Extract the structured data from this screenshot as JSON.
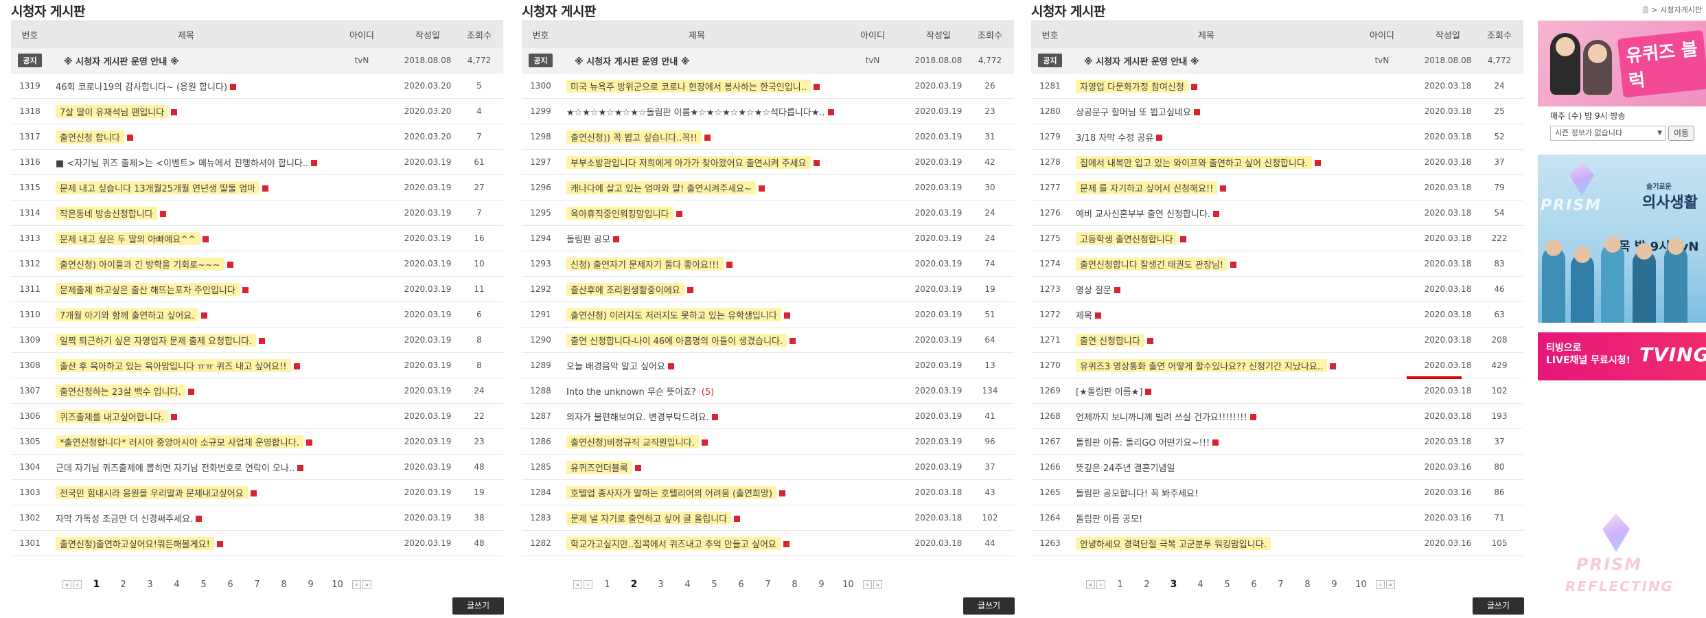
{
  "boards": [
    {
      "title": "시청자 게시판",
      "headers": {
        "num": "번호",
        "title": "제목",
        "id": "아이디",
        "date": "작성일",
        "views": "조회수"
      },
      "notice": {
        "badge": "공지",
        "title": "※ 시청자 게시판 운영 안내 ※",
        "id": "tvN",
        "date": "2018.08.08",
        "views": "4,772"
      },
      "rows": [
        {
          "num": "1319",
          "title": "46회 코로나19의 감사합니다~ (응원 합니다)",
          "date": "2020.03.20",
          "views": "5"
        },
        {
          "num": "1318",
          "title": "7살 딸이 유재석님 팬입니다",
          "date": "2020.03.20",
          "views": "4"
        },
        {
          "num": "1317",
          "title": "출연신청 합니다",
          "date": "2020.03.20",
          "views": "7"
        },
        {
          "num": "1316",
          "title": "■ <자기님 퀴즈 출제>는 <이벤트> 메뉴에서 진행하셔야 합니다..",
          "date": "2020.03.19",
          "views": "61"
        },
        {
          "num": "1315",
          "title": "문제 내고 싶습니다 13개월25개월 연년생 딸둘 엄마",
          "date": "2020.03.19",
          "views": "27"
        },
        {
          "num": "1314",
          "title": "작은동네 방송신청합니다",
          "date": "2020.03.19",
          "views": "7"
        },
        {
          "num": "1313",
          "title": "문제 내고 싶은 두 딸의 아빠예요^^",
          "date": "2020.03.19",
          "views": "16"
        },
        {
          "num": "1312",
          "title": "출연신청) 아이들과 긴 방학을 기회로~~~",
          "date": "2020.03.19",
          "views": "10"
        },
        {
          "num": "1311",
          "title": "문제출제 하고싶은 출산 해뜨는포차 주인입니다",
          "date": "2020.03.19",
          "views": "11"
        },
        {
          "num": "1310",
          "title": "7개월 아기와 함께 출연하고 싶어요.",
          "date": "2020.03.19",
          "views": "6"
        },
        {
          "num": "1309",
          "title": "일찍 퇴근하기 싶은 자영업자 문제 출제 요청합니다.",
          "date": "2020.03.19",
          "views": "8"
        },
        {
          "num": "1308",
          "title": "출산 후 육아하고 있는 육아맘입니다 ㅠㅠ 퀴즈 내고 싶어요!!",
          "date": "2020.03.19",
          "views": "8"
        },
        {
          "num": "1307",
          "title": "출연신청하는 23살 백수 입니다.",
          "date": "2020.03.19",
          "views": "24"
        },
        {
          "num": "1306",
          "title": "퀴즈출제를 내고싶어합니다.",
          "date": "2020.03.19",
          "views": "22"
        },
        {
          "num": "1305",
          "title": "*출연신청합니다* 러시아 중앙아시아 소규모 사업체 운영합니다.",
          "date": "2020.03.19",
          "views": "23"
        },
        {
          "num": "1304",
          "title": "근데 자기님 퀴즈출제에 뽑히면 자기님 전화번호로 연락이 오나..",
          "date": "2020.03.19",
          "views": "48"
        },
        {
          "num": "1303",
          "title": "전국민 힘내시라 응원을 우리말과 문제내고싶어요",
          "date": "2020.03.19",
          "views": "19"
        },
        {
          "num": "1302",
          "title": "자막 가독성 조금만 더 신경써주세요.",
          "date": "2020.03.19",
          "views": "38"
        },
        {
          "num": "1301",
          "title": "출연신청)출연하고싶어요!뭐든해볼게요!",
          "date": "2020.03.19",
          "views": "48"
        }
      ],
      "pages": [
        "1",
        "2",
        "3",
        "4",
        "5",
        "6",
        "7",
        "8",
        "9",
        "10"
      ],
      "active_page": "1",
      "write_label": "글쓰기"
    },
    {
      "title": "시청자 게시판",
      "headers": {
        "num": "번호",
        "title": "제목",
        "id": "아이디",
        "date": "작성일",
        "views": "조회수"
      },
      "notice": {
        "badge": "공지",
        "title": "※ 시청자 게시판 운영 안내 ※",
        "id": "tvN",
        "date": "2018.08.08",
        "views": "4,772"
      },
      "rows": [
        {
          "num": "1300",
          "title": "미국 뉴욕주 방위군으로 코로나 현장에서 봉사하는 한국인입니..",
          "date": "2020.03.19",
          "views": "26"
        },
        {
          "num": "1299",
          "title": "★☆★☆★☆★☆★☆돌림판 이름★☆★☆★☆★☆★☆석다릅니다★..",
          "date": "2020.03.19",
          "views": "23"
        },
        {
          "num": "1298",
          "title": "출연신청)) 꼭 뵙고 싶습니다..꼭!!",
          "date": "2020.03.19",
          "views": "31"
        },
        {
          "num": "1297",
          "title": "부부소방관입니다 저희에게 아가가 찾아왔어요 출연시켜 주세요",
          "date": "2020.03.19",
          "views": "42"
        },
        {
          "num": "1296",
          "title": "캐나다에 살고 있는 엄마와 딸! 출연시켜주세요~",
          "date": "2020.03.19",
          "views": "30"
        },
        {
          "num": "1295",
          "title": "육아휴직중인워킹맘입니다",
          "date": "2020.03.19",
          "views": "24"
        },
        {
          "num": "1294",
          "title": "돌림판 공모",
          "date": "2020.03.19",
          "views": "24"
        },
        {
          "num": "1293",
          "title": "신청) 출연자기 문제자기 둘다 좋아요!!!",
          "date": "2020.03.19",
          "views": "74"
        },
        {
          "num": "1292",
          "title": "출산후에 조리원생활중이에요",
          "date": "2020.03.19",
          "views": "19"
        },
        {
          "num": "1291",
          "title": "출연신청) 이러지도 저러지도 못하고 있는 유학생입니다",
          "date": "2020.03.19",
          "views": "51"
        },
        {
          "num": "1290",
          "title": "출연 신청합니다-나이 46에 아홉명의 아들이 생겼습니다.",
          "date": "2020.03.19",
          "views": "64"
        },
        {
          "num": "1289",
          "title": "오늘 배경음악 알고 싶어요",
          "date": "2020.03.19",
          "views": "13"
        },
        {
          "num": "1288",
          "title": "Into the unknown 무슨 뜻이죠?",
          "comments": "(5)",
          "date": "2020.03.19",
          "views": "134"
        },
        {
          "num": "1287",
          "title": "의자가 불편해보여요. 변경부탁드려요.",
          "date": "2020.03.19",
          "views": "41"
        },
        {
          "num": "1286",
          "title": "출연신청)비정규직 교직원입니다.",
          "date": "2020.03.19",
          "views": "96"
        },
        {
          "num": "1285",
          "title": "유퀴즈언더블록",
          "date": "2020.03.19",
          "views": "37"
        },
        {
          "num": "1284",
          "title": "호텔업 종사자가 말하는 호텔리어의 어려움 (출연희망)",
          "date": "2020.03.18",
          "views": "43"
        },
        {
          "num": "1283",
          "title": "문제 낼 자기로 출연하고 싶어 글 올립니다",
          "date": "2020.03.18",
          "views": "102"
        },
        {
          "num": "1282",
          "title": "학교가고싶지만..집콕에서 퀴즈내고 추억 만들고 싶어요",
          "date": "2020.03.18",
          "views": "44"
        }
      ],
      "pages": [
        "1",
        "2",
        "3",
        "4",
        "5",
        "6",
        "7",
        "8",
        "9",
        "10"
      ],
      "active_page": "2",
      "write_label": "글쓰기"
    },
    {
      "title": "시청자 게시판",
      "headers": {
        "num": "번호",
        "title": "제목",
        "id": "아이디",
        "date": "작성일",
        "views": "조회수"
      },
      "notice": {
        "badge": "공지",
        "title": "※ 시청자 게시판 운영 안내 ※",
        "id": "tvN",
        "date": "2018.08.08",
        "views": "4,772"
      },
      "rows": [
        {
          "num": "1281",
          "title": "자영업 다문화가정 참여신청",
          "date": "2020.03.18",
          "views": "24"
        },
        {
          "num": "1280",
          "title": "상공문구 할머님 또 뵙고싶네요",
          "date": "2020.03.18",
          "views": "25"
        },
        {
          "num": "1279",
          "title": "3/18 자막 수정 공유",
          "date": "2020.03.18",
          "views": "52"
        },
        {
          "num": "1278",
          "title": "집에서 내복만 입고 있는 와이프와 출연하고 싶어 신청합니다.",
          "date": "2020.03.18",
          "views": "37"
        },
        {
          "num": "1277",
          "title": "문제 를 자기하고 싶어서 신청해요!!",
          "date": "2020.03.18",
          "views": "79"
        },
        {
          "num": "1276",
          "title": "예비 교사신혼부부 출연 신청합니다.",
          "date": "2020.03.18",
          "views": "54"
        },
        {
          "num": "1275",
          "title": "고등학생 출연신청합니다",
          "date": "2020.03.18",
          "views": "222"
        },
        {
          "num": "1274",
          "title": "출연신청합니다 잘생긴 태권도 관장님!",
          "date": "2020.03.18",
          "views": "83"
        },
        {
          "num": "1273",
          "title": "영상 질문",
          "date": "2020.03.18",
          "views": "46"
        },
        {
          "num": "1272",
          "title": "제목",
          "date": "2020.03.18",
          "views": "63"
        },
        {
          "num": "1271",
          "title": "출연 신청합니다",
          "date": "2020.03.18",
          "views": "208"
        },
        {
          "num": "1270",
          "title": "유퀴즈3 영상통화 출연 어떻게 할수있나요?? 신청기간 지났나요..",
          "date": "2020.03.18",
          "views": "429"
        },
        {
          "num": "1269",
          "title": "[★돌림판 이름★]",
          "date": "2020.03.18",
          "views": "102"
        },
        {
          "num": "1268",
          "title": "언제까지 보니까니께 빌려 쓰실 건가요!!!!!!!!",
          "date": "2020.03.18",
          "views": "193"
        },
        {
          "num": "1267",
          "title": "돌림판 이름: 돌리GO 어떤가요~!!!",
          "date": "2020.03.18",
          "views": "37"
        },
        {
          "num": "1266",
          "title": "뜻깊은 24주년 결혼기념일",
          "date": "2020.03.16",
          "views": "80"
        },
        {
          "num": "1265",
          "title": "돌림판 공모합니다! 꼭 봐주세요!",
          "date": "2020.03.16",
          "views": "86"
        },
        {
          "num": "1264",
          "title": "돌림판 이름 공모!",
          "date": "2020.03.16",
          "views": "71"
        },
        {
          "num": "1263",
          "title": "안녕하세요 경력단절 극복 고군분투 워킹맘입니다.",
          "date": "2020.03.16",
          "views": "105"
        }
      ],
      "pages": [
        "1",
        "2",
        "3",
        "4",
        "5",
        "6",
        "7",
        "8",
        "9",
        "10"
      ],
      "active_page": "3",
      "write_label": "글쓰기"
    }
  ],
  "sidebar": {
    "breadcrumb_home": "홈",
    "breadcrumb_sep": ">",
    "breadcrumb_current": "시청자게시판",
    "promo1_text": "유퀴즈 블럭",
    "schedule": "매주 (수) 밤 9시 방송",
    "select_value": "시즌 정보가 없습니다",
    "move_label": "이동",
    "promo2_sub": "슬기로운",
    "promo2_title": "의사생활",
    "promo2_time": "목 밤 9시 tvN",
    "promo3_line1": "티빙으로",
    "promo3_line2": "LIVE채널 무료시청!",
    "promo3_brand": "TVING",
    "prism_line1": "PRISM",
    "prism_line2": "REFLECTING"
  },
  "colors": {
    "highlight": "#fff3a6",
    "new_badge": "#d9232f",
    "header_bg": "#e9e9e9",
    "write_button": "#2f2f2f",
    "tving_pink": "#e6177a",
    "annotation_red": "#e00000"
  },
  "highlighted_rows": {
    "0": [
      "1318",
      "1317",
      "1315",
      "1314",
      "1313",
      "1312",
      "1311",
      "1310",
      "1309",
      "1308",
      "1307",
      "1306",
      "1305",
      "1303",
      "1301"
    ],
    "1": [
      "1300",
      "1298",
      "1297",
      "1296",
      "1295",
      "1293",
      "1292",
      "1291",
      "1290",
      "1286",
      "1285",
      "1284",
      "1283",
      "1282"
    ],
    "2": [
      "1281",
      "1278",
      "1277",
      "1275",
      "1274",
      "1271",
      "1270",
      "1263"
    ]
  },
  "new_badge_rows": {
    "0": [
      "1319",
      "1318",
      "1317",
      "1316",
      "1315",
      "1314",
      "1313",
      "1312",
      "1311",
      "1310",
      "1309",
      "1308",
      "1307",
      "1306",
      "1305",
      "1304",
      "1303",
      "1302",
      "1301"
    ],
    "1": [
      "1300",
      "1299",
      "1298",
      "1297",
      "1296",
      "1295",
      "1294",
      "1293",
      "1292",
      "1291",
      "1290",
      "1289",
      "1287",
      "1286",
      "1285",
      "1284",
      "1283",
      "1282"
    ],
    "2": [
      "1281",
      "1280",
      "1279",
      "1278",
      "1277",
      "1276",
      "1275",
      "1274",
      "1273",
      "1272",
      "1271",
      "1270",
      "1269",
      "1268",
      "1267"
    ]
  },
  "red_underline_row": "1270"
}
